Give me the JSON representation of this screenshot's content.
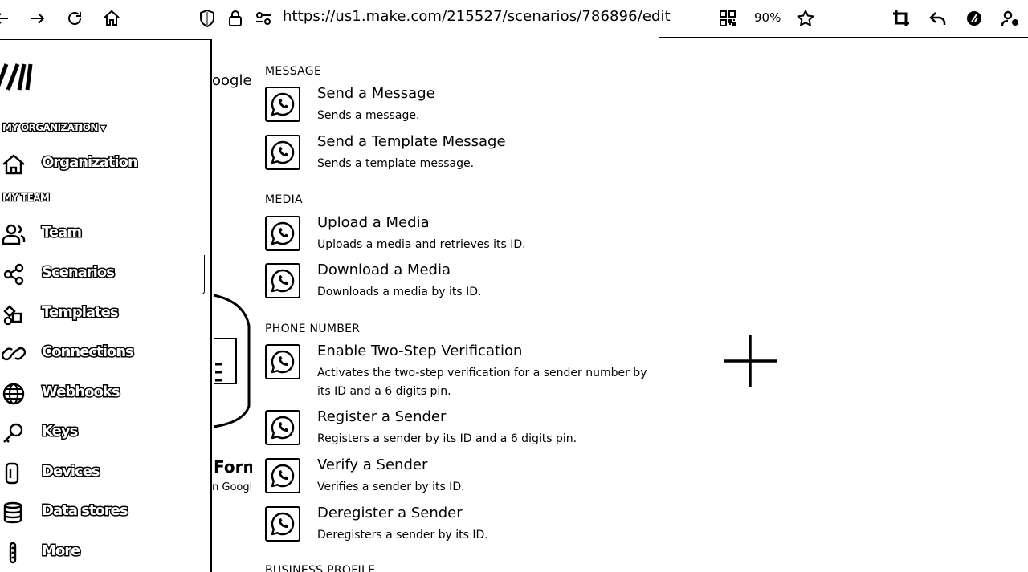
{
  "browser": {
    "url": "https://us1.make.com/215527/scenarios/786896/edit",
    "zoom": "90%",
    "icons": [
      "back-icon",
      "forward-icon",
      "reload-icon",
      "home-icon",
      "shield-icon",
      "lock-icon",
      "permissions-icon",
      "qr-code-icon",
      "bookmark-star-icon",
      "crop-screenshot-icon",
      "undo-icon",
      "extension-icon",
      "account-icon"
    ]
  },
  "sidebar": {
    "org_section": "MY ORGANIZATION",
    "team_section": "MY TEAM",
    "items": [
      {
        "label": "Organization",
        "icon": "home-icon"
      },
      {
        "label": "Team",
        "icon": "users-icon"
      },
      {
        "label": "Scenarios",
        "icon": "share-nodes-icon"
      },
      {
        "label": "Templates",
        "icon": "templates-icon"
      },
      {
        "label": "Connections",
        "icon": "link-icon"
      },
      {
        "label": "Webhooks",
        "icon": "globe-icon"
      },
      {
        "label": "Keys",
        "icon": "key-icon"
      },
      {
        "label": "Devices",
        "icon": "device-icon"
      },
      {
        "label": "Data stores",
        "icon": "database-icon"
      },
      {
        "label": "More",
        "icon": "more-dots-icon"
      }
    ]
  },
  "background": {
    "google_fragment": "oogle",
    "form_fragment": "Form",
    "google_fragment2": "n Googl"
  },
  "modules": {
    "groups": [
      {
        "label": "MESSAGE",
        "items": [
          {
            "title": "Send a Message",
            "desc": "Sends a message."
          },
          {
            "title": "Send a Template Message",
            "desc": "Sends a template message."
          }
        ]
      },
      {
        "label": "MEDIA",
        "items": [
          {
            "title": "Upload a Media",
            "desc": "Uploads a media and retrieves its ID."
          },
          {
            "title": "Download a Media",
            "desc": "Downloads a media by its ID."
          }
        ]
      },
      {
        "label": "PHONE NUMBER",
        "items": [
          {
            "title": "Enable Two-Step Verification",
            "desc": "Activates the two-step verification for a sender number by its ID and a 6 digits pin."
          },
          {
            "title": "Register a Sender",
            "desc": "Registers a sender by its ID and a 6 digits pin."
          },
          {
            "title": "Verify a Sender",
            "desc": "Verifies a sender by its ID."
          },
          {
            "title": "Deregister a Sender",
            "desc": "Deregisters a sender by its ID."
          }
        ]
      },
      {
        "label": "BUSINESS PROFILE",
        "items": []
      }
    ],
    "module_icon": "whatsapp-icon"
  }
}
